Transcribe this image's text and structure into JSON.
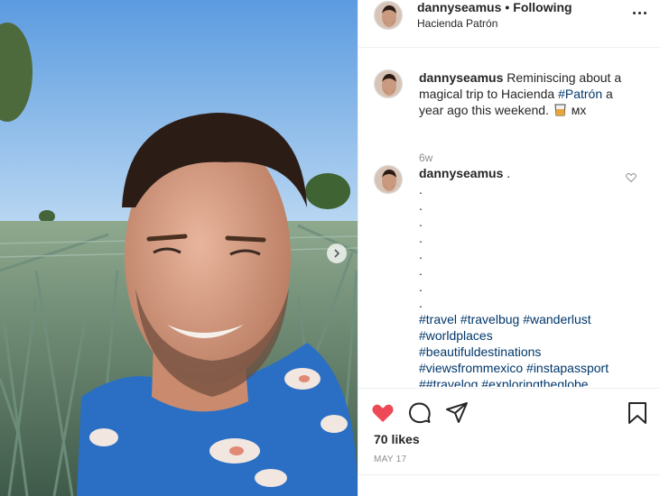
{
  "post": {
    "username": "dannyseamus",
    "separator": "•",
    "follow_label": "Following",
    "location": "Hacienda Patrón"
  },
  "caption": {
    "username": "dannyseamus",
    "text_before": "Reminiscing about a magical trip to Hacienda",
    "hashtag": "#Patrón",
    "text_after": "a year ago this weekend.",
    "country": "мх",
    "age": "6w"
  },
  "comment": {
    "username": "dannyseamus",
    "dot_first": ".",
    "dots": [
      ".",
      ".",
      ".",
      ".",
      ".",
      ".",
      ".",
      "."
    ],
    "hashtag_lines": [
      [
        "#travel",
        "#travelbug",
        "#wanderlust"
      ],
      [
        "#worldplaces"
      ],
      [
        "#beautifuldestinations"
      ],
      [
        "#viewsfrommexico",
        "#instapassport"
      ],
      [
        "##traveloq",
        "#exploringtheglobe"
      ]
    ]
  },
  "actions": {
    "likes": "70 likes",
    "date": "MAY 17",
    "liked": true,
    "like_color": "#ed4956"
  },
  "icons": {
    "like": "heart-icon",
    "comment": "comment-icon",
    "share": "share-icon",
    "save": "bookmark-icon",
    "more": "more-options-icon",
    "next": "chevron-right-icon"
  }
}
